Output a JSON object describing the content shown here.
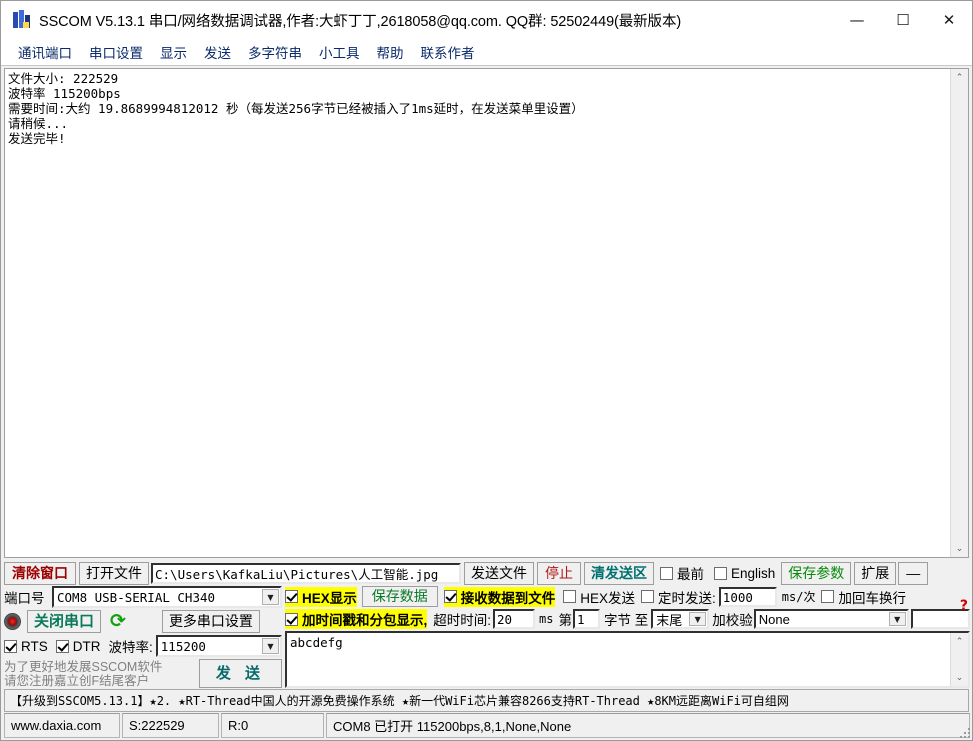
{
  "window": {
    "title": "SSCOM V5.13.1 串口/网络数据调试器,作者:大虾丁丁,2618058@qq.com. QQ群: 52502449(最新版本)",
    "icon": "sscom-app-icon",
    "minimize": "—",
    "maximize": "☐",
    "close": "✕"
  },
  "menubar": {
    "items": [
      {
        "label": "通讯端口"
      },
      {
        "label": "串口设置"
      },
      {
        "label": "显示"
      },
      {
        "label": "发送"
      },
      {
        "label": "多字符串"
      },
      {
        "label": "小工具"
      },
      {
        "label": "帮助"
      },
      {
        "label": "联系作者"
      }
    ]
  },
  "receive_area": {
    "content": "文件大小: 222529\n波特率 115200bps\n需要时间:大约 19.8689994812012 秒（每发送256字节已经被插入了1ms延时，在发送菜单里设置）\n请稍候...\n发送完毕!",
    "scroll_up": "⌃",
    "scroll_down": "⌄"
  },
  "toolbar": {
    "clear_window": "清除窗口",
    "open_file": "打开文件",
    "file_path": "C:\\Users\\KafkaLiu\\Pictures\\人工智能.jpg",
    "send_file": "发送文件",
    "stop": "停止",
    "clear_send": "清发送区",
    "topmost_label": "最前",
    "topmost_checked": false,
    "english_label": "English",
    "english_checked": false,
    "save_params": "保存参数",
    "extend": "扩展",
    "minimize_panel": "—"
  },
  "port_settings": {
    "port_label": "端口号",
    "port_value": "COM8 USB-SERIAL CH340",
    "close_port": "关闭串口",
    "refresh_icon": "refresh-icon",
    "more_settings": "更多串口设置",
    "rts_label": "RTS",
    "rts_checked": true,
    "dtr_label": "DTR",
    "dtr_checked": true,
    "baud_label": "波特率:",
    "baud_value": "115200",
    "promo_line1": "为了更好地发展SSCOM软件",
    "promo_line2": "请您注册嘉立创F结尾客户",
    "send_button": "发 送"
  },
  "display_options": {
    "hex_display_label": "HEX显示",
    "hex_display_checked": true,
    "save_data": "保存数据",
    "recv_to_file_label": "接收数据到文件",
    "recv_to_file_checked": true,
    "hex_send_label": "HEX发送",
    "hex_send_checked": false,
    "timed_send_label": "定时发送:",
    "timed_send_checked": false,
    "timed_send_value": "1000",
    "timed_send_unit": "ms/次",
    "crlf_label": "加回车换行",
    "crlf_checked": false,
    "timestamp_label": "加时间戳和分包显示,",
    "timestamp_checked": true,
    "timeout_label": "超时时间:",
    "timeout_value": "20",
    "timeout_unit": "ms",
    "byte_from_label": "第",
    "byte_from_value": "1",
    "byte_mid_label": "字节 至",
    "byte_to_value": "末尾",
    "checksum_label": "加校验",
    "checksum_value": "None",
    "checksum_extra": "",
    "help_mark": "?"
  },
  "send_area": {
    "content": "abcdefg",
    "scroll_up": "⌃",
    "scroll_down": "⌄"
  },
  "ad_bar": {
    "text": "【升级到SSCOM5.13.1】★2.  ★RT-Thread中国人的开源免费操作系统 ★新一代WiFi芯片兼容8266支持RT-Thread ★8KM远距离WiFi可自组网"
  },
  "status_bar": {
    "website": "www.daxia.com",
    "sent": "S:222529",
    "received": "R:0",
    "connection": "COM8 已打开  115200bps,8,1,None,None"
  },
  "colors": {
    "highlight": "#ffff00",
    "clear_window": "#9c0000",
    "stop": "#b01919",
    "clear_send": "#007070",
    "save_params": "#0a8a0a",
    "save_data": "#0a7a2a",
    "close_port": "#0a7a5a",
    "send_button": "#0a6b6b",
    "menu_text": "#0a2a6b",
    "refresh": "#13a013"
  }
}
